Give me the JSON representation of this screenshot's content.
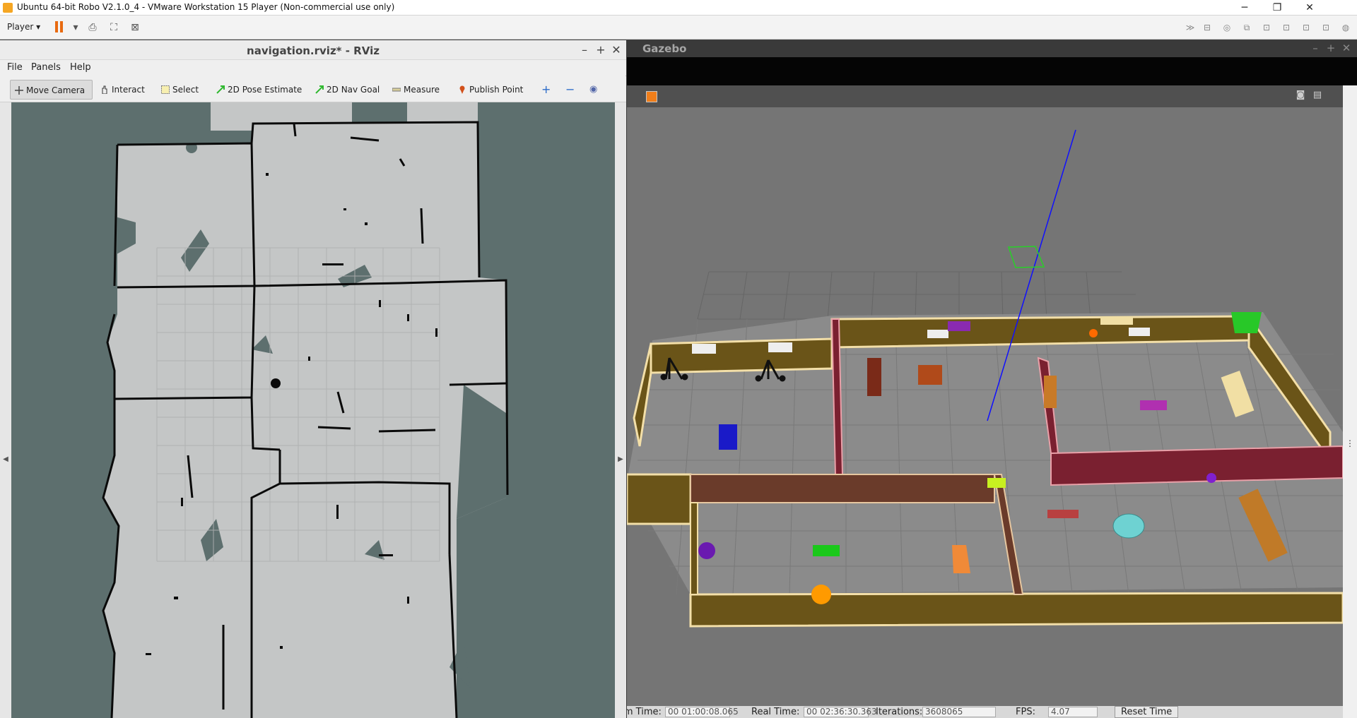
{
  "vm": {
    "title": "Ubuntu 64-bit Robo V2.1.0_4 - VMware Workstation 15 Player (Non-commercial use only)",
    "player_menu": "Player",
    "window_controls": {
      "minimize": "─",
      "restore": "❐",
      "close": "✕"
    }
  },
  "rviz": {
    "title": "navigation.rviz* - RViz",
    "menu": [
      "File",
      "Panels",
      "Help"
    ],
    "tools": [
      {
        "label": "Move Camera",
        "icon": "move-camera-icon",
        "active": true
      },
      {
        "label": "Interact",
        "icon": "hand-icon"
      },
      {
        "label": "Select",
        "icon": "select-box-icon"
      },
      {
        "label": "2D Pose Estimate",
        "icon": "green-arrow-icon"
      },
      {
        "label": "2D Nav Goal",
        "icon": "green-arrow-icon"
      },
      {
        "label": "Measure",
        "icon": "ruler-icon"
      },
      {
        "label": "Publish Point",
        "icon": "pin-icon"
      }
    ],
    "map_colors": {
      "unknown": "#5d6f6e",
      "free": "#c4c6c6",
      "occupied": "#0a0a0a"
    }
  },
  "gazebo": {
    "title": "Gazebo",
    "status": {
      "sim_time_label": "Sim Time:",
      "sim_time": "00 01:00:08.065",
      "real_time_label": "Real Time:",
      "real_time": "00 02:36:30.363",
      "iterations_label": "Iterations:",
      "iterations": "3608065",
      "fps_label": "FPS:",
      "fps": "4.07",
      "reset_label": "Reset Time"
    },
    "colors": {
      "floor": "#7a7a7a",
      "wall": "#6a5418",
      "wall_top": "#f3dfa8",
      "inner_wall": "#7a2030",
      "path_line": "#1010ff"
    }
  }
}
